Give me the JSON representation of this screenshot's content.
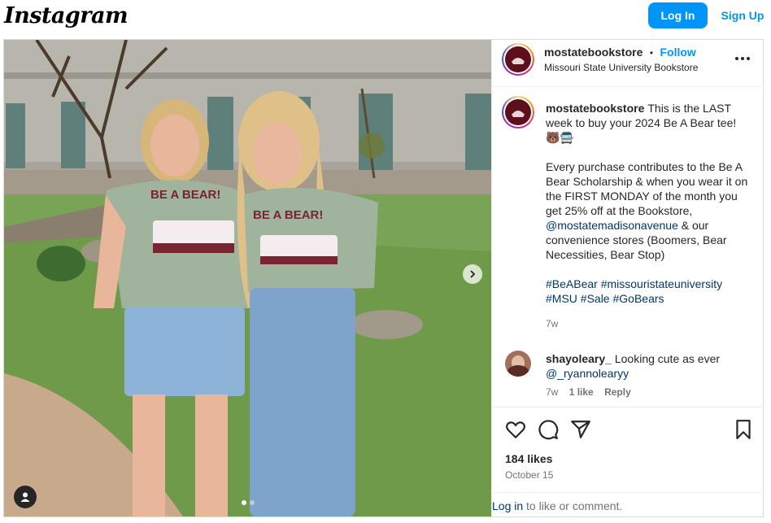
{
  "topbar": {
    "logo_text": "Instagram",
    "login_label": "Log In",
    "signup_label": "Sign Up"
  },
  "post": {
    "author": {
      "username": "mostatebookstore",
      "separator": "•",
      "follow_label": "Follow",
      "display_name": "Missouri State University Bookstore"
    },
    "caption": {
      "username": "mostatebookstore",
      "line1": "This is the LAST week to buy your 2024 Be A Bear tee! 🐻🚍",
      "line2_before": "Every purchase contributes to the Be A Bear Scholarship & when you wear it on the FIRST MONDAY of the month you get 25% off at the Bookstore, ",
      "mention": "@mostatemadisonavenue",
      "line2_after": " & our convenience stores (Boomers, Bear Necessities, Bear Stop)",
      "hashtags": "#BeABear #missouristateuniversity #MSU #Sale #GoBears",
      "age": "7w"
    },
    "comment": {
      "username": "shayoleary_",
      "text": "Looking cute as ever",
      "mention": "@_ryannolearyy",
      "age": "7w",
      "likes": "1 like",
      "reply_label": "Reply"
    },
    "likes": "184 likes",
    "date": "October 15",
    "login_prompt": {
      "link": "Log in",
      "rest": " to like or comment."
    },
    "image": {
      "shirt_text": "BE A BEAR!",
      "carousel_position": 1,
      "carousel_count": 2
    }
  },
  "colors": {
    "brand_blue": "#0095f6",
    "link_blue": "#00376b",
    "maroon": "#5e0f1c",
    "shirt_green": "#9fb39d"
  },
  "icons": [
    "heart-icon",
    "comment-icon",
    "share-icon",
    "bookmark-icon",
    "more-icon",
    "chevron-right-icon",
    "user-tag-icon"
  ]
}
